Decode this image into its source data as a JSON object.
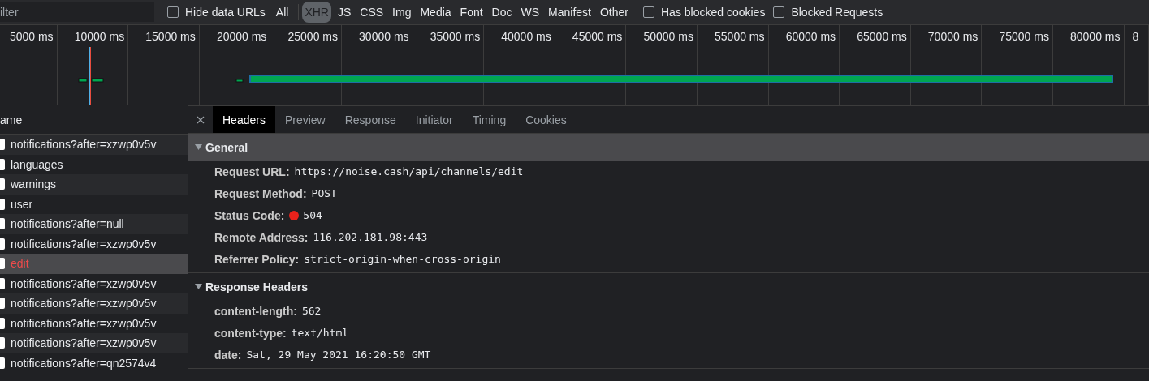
{
  "toolbar": {
    "filter": {
      "placeholder": "ilter"
    },
    "hide_data_urls": {
      "label": "Hide data URLs",
      "checked": false
    },
    "types": [
      {
        "label": "All",
        "selected": false
      },
      {
        "label": "XHR",
        "selected": true
      },
      {
        "label": "JS",
        "selected": false
      },
      {
        "label": "CSS",
        "selected": false
      },
      {
        "label": "Img",
        "selected": false
      },
      {
        "label": "Media",
        "selected": false
      },
      {
        "label": "Font",
        "selected": false
      },
      {
        "label": "Doc",
        "selected": false
      },
      {
        "label": "WS",
        "selected": false
      },
      {
        "label": "Manifest",
        "selected": false
      },
      {
        "label": "Other",
        "selected": false
      }
    ],
    "options": [
      {
        "label": "Has blocked cookies",
        "checked": false
      },
      {
        "label": "Blocked Requests",
        "checked": false
      }
    ]
  },
  "timeline": {
    "ticks": [
      "5000 ms",
      "10000 ms",
      "15000 ms",
      "20000 ms",
      "25000 ms",
      "30000 ms",
      "35000 ms",
      "40000 ms",
      "45000 ms",
      "50000 ms",
      "55000 ms",
      "60000 ms",
      "65000 ms",
      "70000 ms",
      "75000 ms",
      "80000 ms",
      "8"
    ]
  },
  "requests": {
    "column": "ame",
    "rows": [
      {
        "name": "notifications?after=xzwp0v5v",
        "selected": false,
        "failed": false
      },
      {
        "name": "languages",
        "selected": false,
        "failed": false
      },
      {
        "name": "warnings",
        "selected": false,
        "failed": false
      },
      {
        "name": "user",
        "selected": false,
        "failed": false
      },
      {
        "name": "notifications?after=null",
        "selected": false,
        "failed": false
      },
      {
        "name": "notifications?after=xzwp0v5v",
        "selected": false,
        "failed": false
      },
      {
        "name": "edit",
        "selected": true,
        "failed": true
      },
      {
        "name": "notifications?after=xzwp0v5v",
        "selected": false,
        "failed": false
      },
      {
        "name": "notifications?after=xzwp0v5v",
        "selected": false,
        "failed": false
      },
      {
        "name": "notifications?after=xzwp0v5v",
        "selected": false,
        "failed": false
      },
      {
        "name": "notifications?after=xzwp0v5v",
        "selected": false,
        "failed": false
      },
      {
        "name": "notifications?after=qn2574v4",
        "selected": false,
        "failed": false
      }
    ]
  },
  "details": {
    "tabs": [
      {
        "label": "Headers",
        "selected": true
      },
      {
        "label": "Preview",
        "selected": false
      },
      {
        "label": "Response",
        "selected": false
      },
      {
        "label": "Initiator",
        "selected": false
      },
      {
        "label": "Timing",
        "selected": false
      },
      {
        "label": "Cookies",
        "selected": false
      }
    ],
    "sections": [
      {
        "title": "General",
        "expanded": true,
        "highlighted": true,
        "rows": [
          {
            "name": "Request URL:",
            "value": "https://noise.cash/api/channels/edit"
          },
          {
            "name": "Request Method:",
            "value": "POST"
          },
          {
            "name": "Status Code:",
            "value": "504",
            "color": "#e8221b"
          },
          {
            "name": "Remote Address:",
            "value": "116.202.181.98:443"
          },
          {
            "name": "Referrer Policy:",
            "value": "strict-origin-when-cross-origin"
          }
        ]
      },
      {
        "title": "Response Headers",
        "expanded": true,
        "highlighted": false,
        "rows": [
          {
            "name": "content-length:",
            "value": "562"
          },
          {
            "name": "content-type:",
            "value": "text/html"
          },
          {
            "name": "date:",
            "value": "Sat, 29 May 2021 16:20:50 GMT"
          }
        ]
      }
    ]
  }
}
